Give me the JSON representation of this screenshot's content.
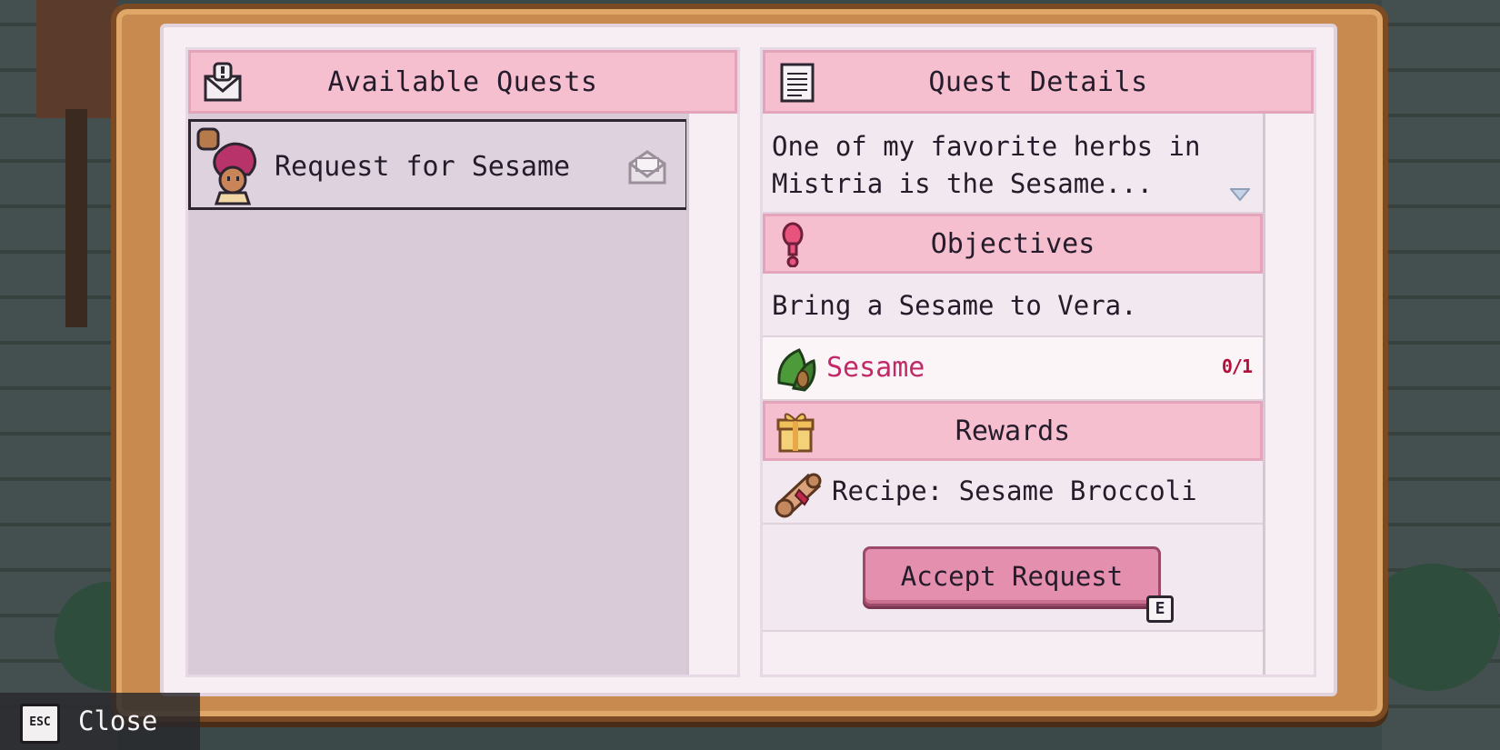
{
  "quest_board": {
    "available_title": "Available Quests",
    "details_title": "Quest Details",
    "quests": [
      {
        "label": "Request for Sesame"
      }
    ],
    "details": {
      "description_line1": "One of my favorite herbs in",
      "description_line2": "Mistria is the Sesame...",
      "objectives_title": "Objectives",
      "objective_text": "Bring a Sesame to Vera.",
      "objective_item": "Sesame",
      "objective_count": "0/1",
      "rewards_title": "Rewards",
      "reward_item": "Recipe: Sesame Broccoli",
      "accept_label": "Accept Request",
      "accept_key": "E"
    }
  },
  "footer": {
    "close_key": "ESC",
    "close_label": "Close"
  },
  "colors": {
    "header_pink": "#f6bfd0",
    "button_pink": "#e48fae",
    "item_name": "#c02a66",
    "frame_wood": "#c98a4f"
  }
}
